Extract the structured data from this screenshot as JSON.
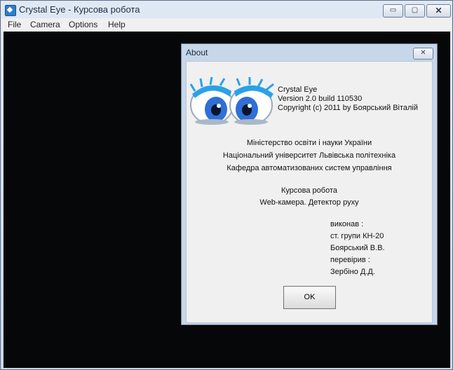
{
  "window": {
    "title": "Crystal Eye - Курсова робота",
    "controls": {
      "minimize": "▭",
      "maximize": "▢",
      "close": "✕"
    }
  },
  "menu": {
    "items": [
      "File",
      "Camera",
      "Options",
      "Help"
    ]
  },
  "dialog": {
    "title": "About",
    "close_glyph": "✕",
    "app_name": "Crystal Eye",
    "version": "Version 2.0 build 110530",
    "copyright": "Copyright (c) 2011 by Боярський Віталій",
    "institution_lines": [
      "Міністерство освіти і науки України",
      "Національний університет Львівська політехніка",
      "Кафедра автоматизованих систем управління"
    ],
    "project_lines": [
      "Курсова робота",
      "Web-камера. Детектор руху"
    ],
    "credit_lines": [
      "виконав :",
      "ст. групи КН-20",
      "Боярський В.В.",
      "перевірив :",
      "Зербіно Д.Д."
    ],
    "ok_label": "OK"
  },
  "colors": {
    "video_bg": "#060708",
    "eye_iris": "#2f6fd6",
    "eyelash": "#2aa1e8"
  },
  "icons": [
    "app-icon",
    "eyes-logo-icon"
  ]
}
